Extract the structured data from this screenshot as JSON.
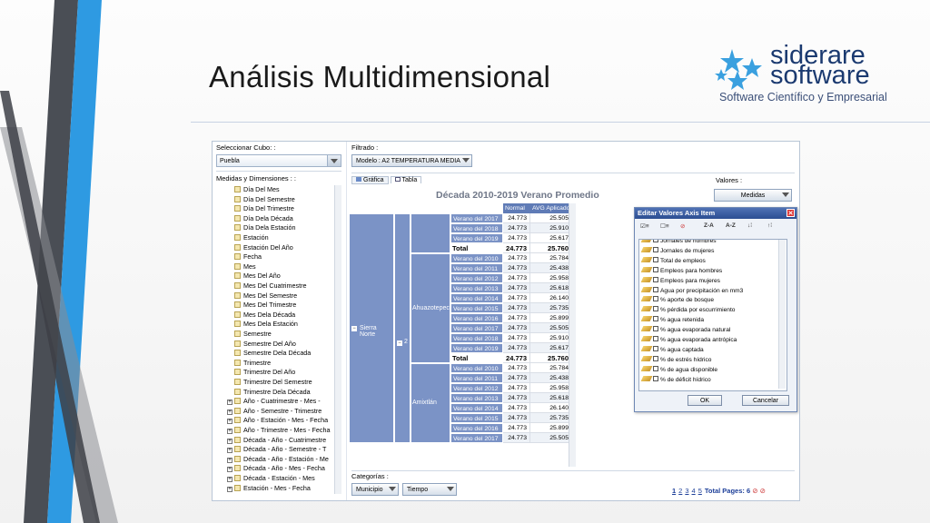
{
  "slide": {
    "title": "Análisis Multidimensional",
    "logo": {
      "word1": "siderare",
      "word2": "software",
      "tagline": "Software Científico y Empresarial"
    },
    "colors": {
      "stripe_blue": "#2e9ae2",
      "stripe_grey": "#5b5f66",
      "title_text": "#1a1a1a",
      "logo_navy": "#1b3a70",
      "logo_star": "#3aa0df"
    }
  },
  "app": {
    "cube": {
      "label": "Seleccionar Cubo: :",
      "value": "Puebla"
    },
    "filter": {
      "label": "Filtrado :",
      "value": "Modelo : A2 TEMPERATURA MEDIA"
    },
    "dimensions": {
      "label": "Medidas y Dimensiones : :",
      "items": [
        "Día Del Mes",
        "Día Del Semestre",
        "Día Del Trimestre",
        "Día Dela Década",
        "Día Dela Estación",
        "Estación",
        "Estación Del Año",
        "Fecha",
        "Mes",
        "Mes Del Año",
        "Mes Del Cuatrimestre",
        "Mes Del Semestre",
        "Mes Del Trimestre",
        "Mes Dela Década",
        "Mes Dela Estación",
        "Semestre",
        "Semestre Del Año",
        "Semestre Dela Década",
        "Trimestre",
        "Trimestre Del Año",
        "Trimestre Del Semestre",
        "Trimestre Dela Década"
      ],
      "hier": [
        "Año - Cuatrimestre - Mes -",
        "Año - Semestre - Trimestre",
        "Año - Estación - Mes - Fecha",
        "Año - Trimestre - Mes - Fecha",
        "Década - Año - Cuatrimestre",
        "Década - Año - Semestre - T",
        "Década - Año - Estación - Me",
        "Década - Año - Mes - Fecha",
        "Década - Estación - Mes",
        "Estación - Mes - Fecha"
      ]
    },
    "tabs": {
      "chart": "Gráfica",
      "table": "Tabla"
    },
    "values": {
      "label": "Valores :",
      "value": "Medidas"
    },
    "categories": {
      "label": "Categorías :",
      "municipio": "Municipio",
      "tiempo": "Tiempo"
    },
    "table": {
      "title": "Década 2010-2019 Verano Promedio",
      "col_normal": "Normal",
      "col_avg": "AVG Aplicado",
      "region": "Sierra Norte",
      "group_num": "2",
      "muni1": "Ahuazotepec",
      "muni2": "Amixtlán",
      "total_label": "Total",
      "top_rows": [
        {
          "label": "Verano del 2017",
          "n": "24.773",
          "a": "25.505"
        },
        {
          "label": "Verano del 2018",
          "n": "24.773",
          "a": "25.910"
        },
        {
          "label": "Verano del 2019",
          "n": "24.773",
          "a": "25.617"
        }
      ],
      "top_total": {
        "n": "24.773",
        "a": "25.760"
      },
      "ahua_rows": [
        {
          "label": "Verano del 2010",
          "n": "24.773",
          "a": "25.784"
        },
        {
          "label": "Verano del 2011",
          "n": "24.773",
          "a": "25.438"
        },
        {
          "label": "Verano del 2012",
          "n": "24.773",
          "a": "25.958"
        },
        {
          "label": "Verano del 2013",
          "n": "24.773",
          "a": "25.618"
        },
        {
          "label": "Verano del 2014",
          "n": "24.773",
          "a": "26.140"
        },
        {
          "label": "Verano del 2015",
          "n": "24.773",
          "a": "25.735"
        },
        {
          "label": "Verano del 2016",
          "n": "24.773",
          "a": "25.899"
        },
        {
          "label": "Verano del 2017",
          "n": "24.773",
          "a": "25.505"
        },
        {
          "label": "Verano del 2018",
          "n": "24.773",
          "a": "25.910"
        },
        {
          "label": "Verano del 2019",
          "n": "24.773",
          "a": "25.617"
        }
      ],
      "ahua_total": {
        "n": "24.773",
        "a": "25.760"
      },
      "amix_rows": [
        {
          "label": "Verano del 2010",
          "n": "24.773",
          "a": "25.784"
        },
        {
          "label": "Verano del 2011",
          "n": "24.773",
          "a": "25.438"
        },
        {
          "label": "Verano del 2012",
          "n": "24.773",
          "a": "25.958"
        },
        {
          "label": "Verano del 2013",
          "n": "24.773",
          "a": "25.618"
        },
        {
          "label": "Verano del 2014",
          "n": "24.773",
          "a": "26.140"
        },
        {
          "label": "Verano del 2015",
          "n": "24.773",
          "a": "25.735"
        },
        {
          "label": "Verano del 2016",
          "n": "24.773",
          "a": "25.899"
        },
        {
          "label": "Verano del 2017",
          "n": "24.773",
          "a": "25.505"
        }
      ]
    },
    "dialog": {
      "title": "Editar Valores Axis Item",
      "sort_za": "Z-A",
      "sort_az": "A-Z",
      "items": [
        "Jornales de hombres",
        "Jornales de mujeres",
        "Total de empleos",
        "Empleos para hombres",
        "Empleos para mujeres",
        "Agua por precipitación en mm3",
        "% aporte de bosque",
        "% pérdida por escurrimiento",
        "% agua retenida",
        "% agua evaporada natural",
        "% agua evaporada antrópica",
        "% agua captada",
        "% de estrés hídrico",
        "% de agua disponible",
        "% de déficit hídrico"
      ],
      "ok": "OK",
      "cancel": "Cancelar"
    },
    "pager": {
      "pages": [
        "1",
        "2",
        "3",
        "4",
        "5"
      ],
      "current": "1",
      "total": "Total Pages: 6"
    }
  }
}
